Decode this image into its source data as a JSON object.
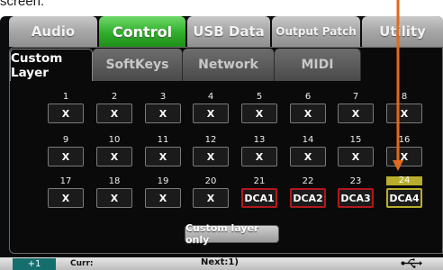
{
  "caption": "screen:",
  "tabs": [
    {
      "label": "Audio",
      "active": false
    },
    {
      "label": "Control",
      "active": true
    },
    {
      "label": "USB Data",
      "active": false
    },
    {
      "label": "Output Patch",
      "active": false
    },
    {
      "label": "Utility",
      "active": false
    }
  ],
  "subtabs": [
    {
      "label": "Custom Layer",
      "active": true
    },
    {
      "label": "SoftKeys",
      "active": false
    },
    {
      "label": "Network",
      "active": false
    },
    {
      "label": "MIDI",
      "active": false
    }
  ],
  "slots": [
    {
      "num": "1",
      "label": "X"
    },
    {
      "num": "2",
      "label": "X"
    },
    {
      "num": "3",
      "label": "X"
    },
    {
      "num": "4",
      "label": "X"
    },
    {
      "num": "5",
      "label": "X"
    },
    {
      "num": "6",
      "label": "X"
    },
    {
      "num": "7",
      "label": "X"
    },
    {
      "num": "8",
      "label": "X"
    },
    {
      "num": "9",
      "label": "X"
    },
    {
      "num": "10",
      "label": "X"
    },
    {
      "num": "11",
      "label": "X"
    },
    {
      "num": "12",
      "label": "X"
    },
    {
      "num": "13",
      "label": "X"
    },
    {
      "num": "14",
      "label": "X"
    },
    {
      "num": "15",
      "label": "X"
    },
    {
      "num": "16",
      "label": "X"
    },
    {
      "num": "17",
      "label": "X"
    },
    {
      "num": "18",
      "label": "X"
    },
    {
      "num": "19",
      "label": "X"
    },
    {
      "num": "20",
      "label": "X"
    },
    {
      "num": "21",
      "label": "DCA1"
    },
    {
      "num": "22",
      "label": "DCA2"
    },
    {
      "num": "23",
      "label": "DCA3"
    },
    {
      "num": "24",
      "label": "DCA4"
    }
  ],
  "custom_layer_only_label": "Custom layer only",
  "status_bar": {
    "page": "+1",
    "curr_label": "Curr:",
    "next_label": "Next:1)",
    "usb_icon": "usb-icon"
  },
  "colors": {
    "active_tab": "#2fae2a",
    "dca_border": "#b3171d",
    "selected_slot": "#b8ae2c",
    "annotation_arrow": "#e06a1e",
    "status_page": "#156e6e"
  }
}
